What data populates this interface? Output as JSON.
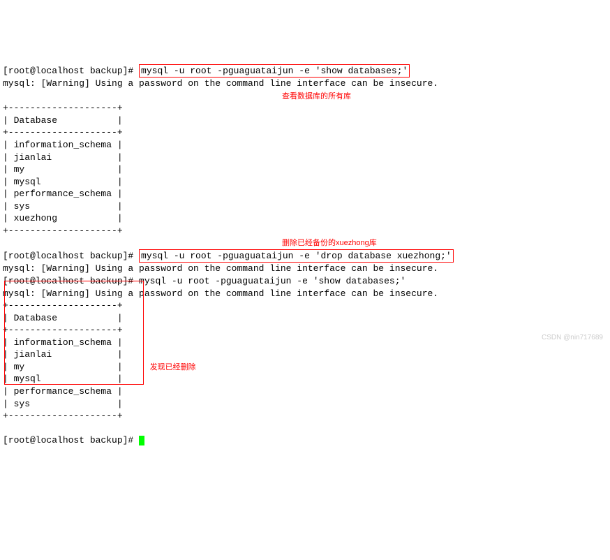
{
  "prompt1": "[root@localhost backup]# ",
  "cmd1": "mysql -u root -pguaguataijun -e 'show databases;'",
  "warning": "mysql: [Warning] Using a password on the command line interface can be insecure.",
  "annotation1": "查看数据库的所有库",
  "table_border": "+--------------------+",
  "table_header": "| Database           |",
  "db1": "| information_schema |",
  "db2": "| jianlai            |",
  "db3": "| my                 |",
  "db4": "| mysql              |",
  "db5": "| performance_schema |",
  "db6": "| sys                |",
  "db7": "| xuezhong           |",
  "annotation2": "删除已经备份的xuezhong库",
  "prompt2": "[root@localhost backup]# ",
  "cmd2": "mysql -u root -pguaguataijun -e 'drop database xuezhong;'",
  "prompt3": "[root@localhost backup]# ",
  "cmd3": "mysql -u root -pguaguataijun -e 'show databases;'",
  "annotation3": "发现已经删除",
  "prompt4": "[root@localhost backup]# ",
  "watermark": "CSDN @nin717689"
}
